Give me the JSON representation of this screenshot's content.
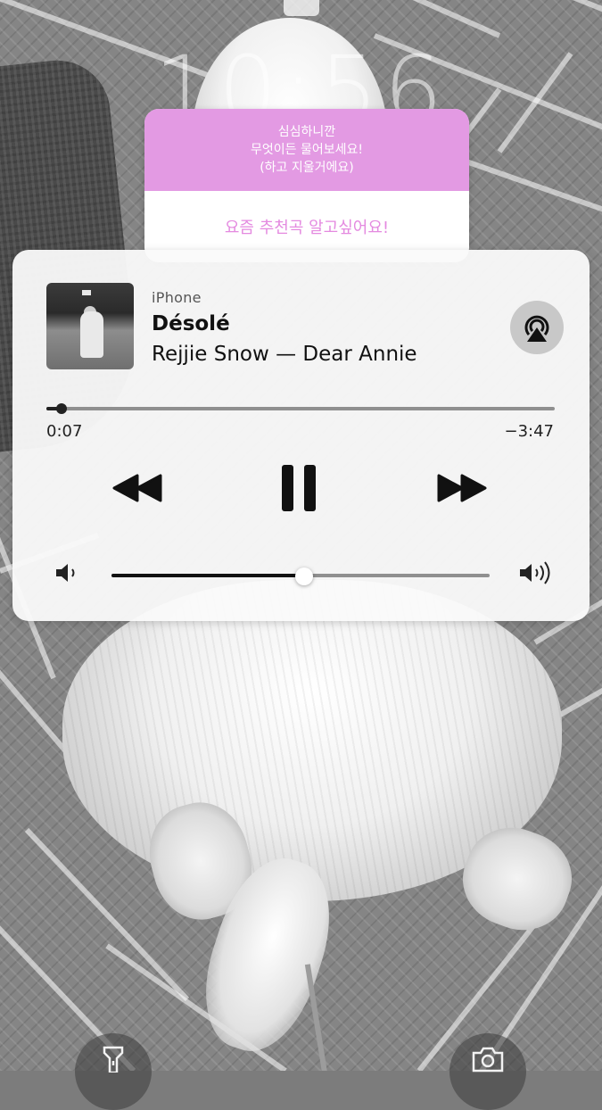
{
  "lock_screen": {
    "clock": "10:56"
  },
  "question_sticker": {
    "prompt_lines": [
      "심심하니깐",
      "무엇이든 물어보세요!",
      "(하고 지울거에요)"
    ],
    "answer": "요즘 추천곡 알고싶어요!",
    "header_color": "#e39ae3",
    "answer_color": "#e48ae0"
  },
  "now_playing": {
    "source": "iPhone",
    "title": "Désolé",
    "subtitle": "Rejjie Snow — Dear Annie",
    "elapsed": "0:07",
    "remaining": "−3:47",
    "progress": 0.03,
    "volume": 0.51,
    "controls": {
      "rewind": "rewind-icon",
      "pause": "pause-icon",
      "forward": "fast-forward-icon",
      "airplay": "airplay-icon",
      "volume_low": "speaker-low-icon",
      "volume_high": "speaker-high-icon"
    }
  },
  "bottom_buttons": {
    "left": "flashlight-icon",
    "right": "camera-icon"
  }
}
